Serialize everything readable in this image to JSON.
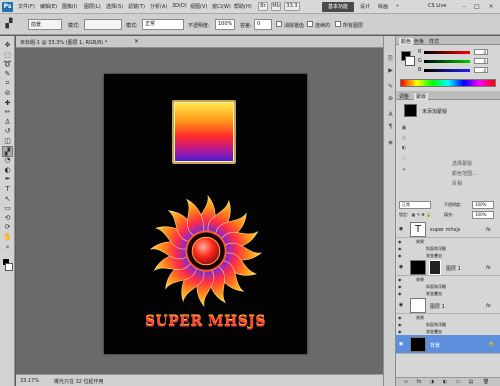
{
  "app": {
    "logo": "Ps"
  },
  "menu": [
    "文件(F)",
    "编辑(E)",
    "图像(I)",
    "图层(L)",
    "选择(S)",
    "滤镜(T)",
    "分析(A)",
    "3D(D)",
    "视图(V)",
    "窗口(W)",
    "帮助(H)"
  ],
  "topbar": {
    "icons": [
      "Br",
      "Mb"
    ],
    "zoom": "33.3",
    "workspace_active": "基本功能",
    "workspaces": [
      "设计",
      "绘画"
    ],
    "more": "»",
    "cslive": "CS Live",
    "window_controls": [
      "–",
      "□",
      "×"
    ]
  },
  "options": {
    "tool_icon": "paint-bucket-icon",
    "tool_glyph": "▞",
    "fill_source": "前景",
    "pattern_label": "模式:",
    "mode_value": "正常",
    "opacity_label": "不透明度:",
    "opacity_value": "100%",
    "tolerance_label": "容差:",
    "tolerance_value": "0",
    "anti_alias": "消除锯齿",
    "contiguous": "连续的",
    "all_layers": "所有图层"
  },
  "tools": [
    {
      "name": "move-tool",
      "glyph": "✥"
    },
    {
      "name": "marquee-tool",
      "glyph": "⬚"
    },
    {
      "name": "lasso-tool",
      "glyph": "➰"
    },
    {
      "name": "quick-select-tool",
      "glyph": "✎"
    },
    {
      "name": "crop-tool",
      "glyph": "⌗"
    },
    {
      "name": "eyedropper-tool",
      "glyph": "⊘"
    },
    {
      "name": "healing-brush-tool",
      "glyph": "✚"
    },
    {
      "name": "brush-tool",
      "glyph": "✏"
    },
    {
      "name": "clone-stamp-tool",
      "glyph": "♙"
    },
    {
      "name": "history-brush-tool",
      "glyph": "↺"
    },
    {
      "name": "eraser-tool",
      "glyph": "◫"
    },
    {
      "name": "paint-bucket-tool",
      "glyph": "▞"
    },
    {
      "name": "blur-tool",
      "glyph": "◔"
    },
    {
      "name": "dodge-tool",
      "glyph": "◐"
    },
    {
      "name": "pen-tool",
      "glyph": "✒"
    },
    {
      "name": "type-tool",
      "glyph": "T"
    },
    {
      "name": "path-select-tool",
      "glyph": "↖"
    },
    {
      "name": "shape-tool",
      "glyph": "▭"
    },
    {
      "name": "3d-rotate-tool",
      "glyph": "⟲"
    },
    {
      "name": "3d-camera-tool",
      "glyph": "⟳"
    },
    {
      "name": "hand-tool",
      "glyph": "✋"
    },
    {
      "name": "zoom-tool",
      "glyph": "⌕"
    }
  ],
  "document": {
    "tab_label": "未标题-1 @ 33.3% (图层 1, RGB/8) *",
    "close": "×",
    "artwork_text": "SUPER MHSJS",
    "status_zoom": "33.17%",
    "status_info": "曝光只在 32 位起作用"
  },
  "color_panel": {
    "tabs": [
      "颜色",
      "色板",
      "样式"
    ],
    "channels": [
      {
        "letter": "R",
        "value": "0",
        "color": "#e43a3a"
      },
      {
        "letter": "G",
        "value": "0",
        "color": "#2fb02f"
      },
      {
        "letter": "B",
        "value": "0",
        "color": "#3a5ae4"
      }
    ]
  },
  "adjust_panel": {
    "tabs": [
      "调整",
      "蒙版"
    ],
    "title": "未添加蒙版",
    "items": [
      "选择蒙版",
      "颜色范围...",
      "反相"
    ]
  },
  "layers_panel": {
    "tabs": [
      "图层",
      "通道",
      "路径"
    ],
    "blend_mode": "正常",
    "opacity_label": "不透明度:",
    "opacity_value": "100%",
    "lock_label": "锁定:",
    "fill_label": "填充:",
    "fill_value": "100%",
    "layers": [
      {
        "name": "super mhsjs",
        "kind": "text",
        "fx": "fx",
        "effects_label": "效果",
        "effects": [
          "斜面和浮雕",
          "渐变叠加"
        ]
      },
      {
        "name": "图层 1",
        "kind": "mask",
        "fx": "fx",
        "effects_label": "效果",
        "effects": [
          "斜面和浮雕",
          "渐变叠加"
        ]
      },
      {
        "name": "图层 1",
        "kind": "white",
        "fx": "fx",
        "effects_label": "效果",
        "effects": [
          "斜面和浮雕",
          "渐变叠加"
        ]
      },
      {
        "name": "背景",
        "kind": "bg",
        "fx": "",
        "effects_label": "",
        "effects": []
      }
    ],
    "footer_icons": [
      "∞",
      "fx",
      "◑",
      "◐",
      "▭",
      "▤",
      "🗑"
    ]
  },
  "colors": {
    "selection": "#5d8fdc",
    "frame_gold": "#c6a84a",
    "text_red": "#ff4e2a"
  },
  "chart_data": null
}
